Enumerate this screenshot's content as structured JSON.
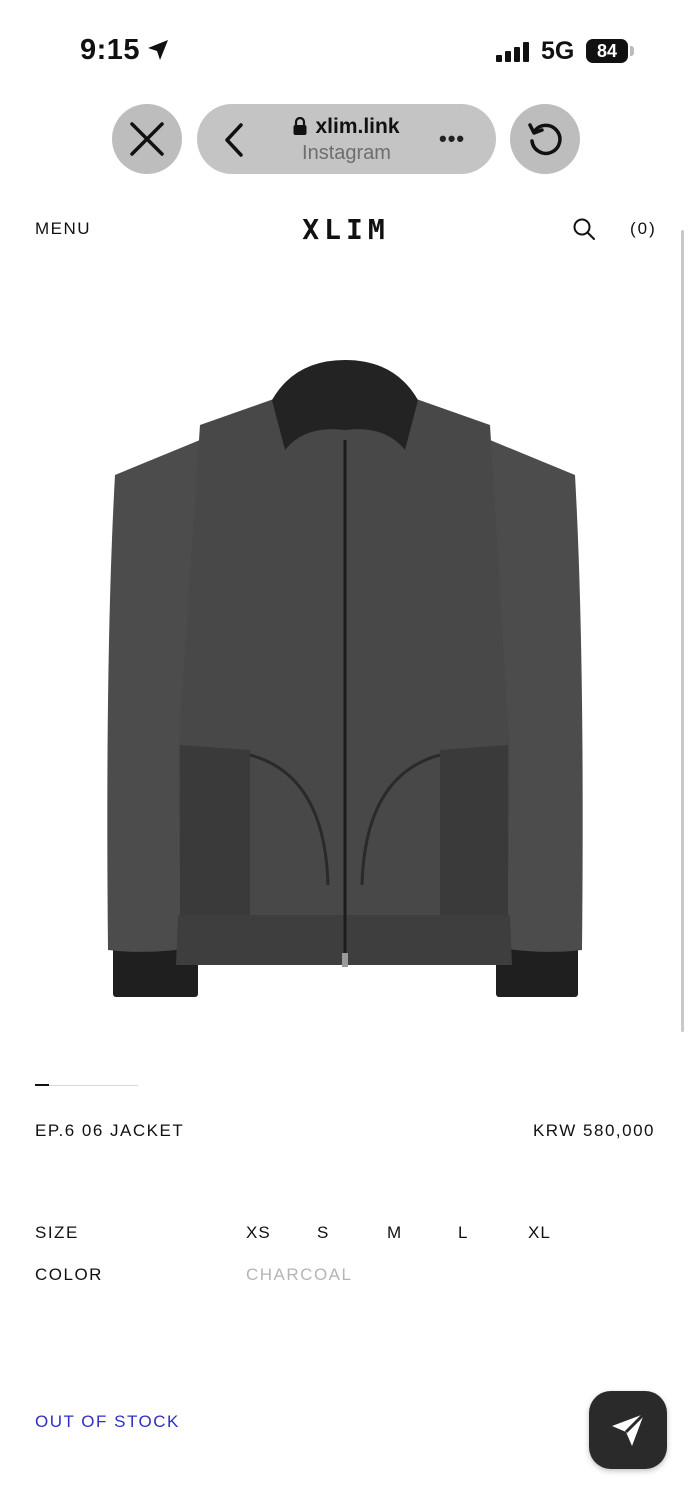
{
  "status_bar": {
    "time": "9:15",
    "network": "5G",
    "battery": "84"
  },
  "browser": {
    "domain": "xlim.link",
    "source": "Instagram",
    "more_label": "•••"
  },
  "header": {
    "menu_label": "MENU",
    "logo": "XLIM",
    "cart_label": "(0)"
  },
  "carousel": {
    "active_index": 1,
    "total": 7
  },
  "product": {
    "name": "EP.6 06 JACKET",
    "price": "KRW 580,000",
    "size_label": "SIZE",
    "sizes": [
      "XS",
      "S",
      "M",
      "L",
      "XL"
    ],
    "color_label": "COLOR",
    "color_value": "CHARCOAL",
    "stock_status": "OUT OF STOCK"
  },
  "colors": {
    "stock_text": "#2f2fc4",
    "jacket": "#4a4a4a",
    "send_button": "#2a2a2a"
  }
}
